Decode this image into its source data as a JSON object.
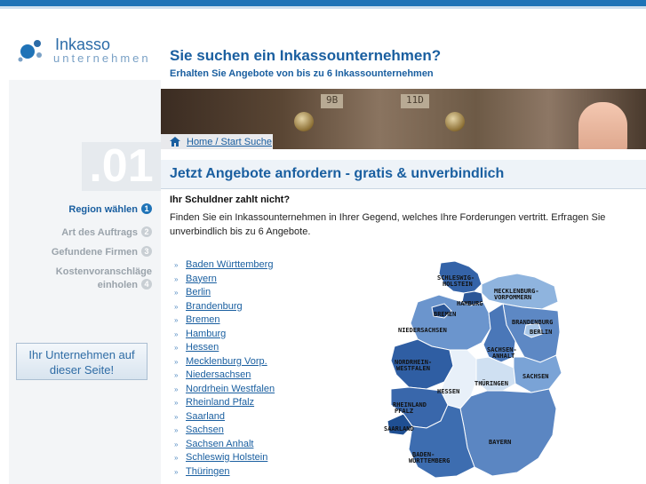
{
  "logo": {
    "line1": "Inkasso",
    "line2": "unternehmen"
  },
  "header": {
    "title": "Sie suchen ein Inkassounternehmen?",
    "subtitle": "Erhalten Sie Angebote von bis zu 6 Inkassounternehmen"
  },
  "photo": {
    "plate1": "9B",
    "plate2": "11D"
  },
  "breadcrumb": {
    "label": "Home / Start Suche"
  },
  "step_number": ".01",
  "main": {
    "title": "Jetzt Angebote anfordern - gratis & unverbindlich",
    "question": "Ihr Schuldner zahlt nicht?",
    "text": "Finden Sie ein Inkassounternehmen in Ihrer Gegend, welches Ihre Forderungen vertritt. Erfragen Sie unverbindlich bis zu 6 Angebote."
  },
  "steps": [
    {
      "label": "Region wählen",
      "num": "1",
      "active": true
    },
    {
      "label": "Art des Auftrags",
      "num": "2",
      "active": false
    },
    {
      "label": "Gefundene Firmen",
      "num": "3",
      "active": false
    },
    {
      "label": "Kostenvoranschläge einholen",
      "num": "4",
      "active": false
    }
  ],
  "side_button": {
    "line1": "Ihr Unternehmen auf",
    "line2": "dieser Seite!"
  },
  "regions": [
    "Baden Württemberg",
    "Bayern",
    "Berlin",
    "Brandenburg",
    "Bremen",
    "Hamburg",
    "Hessen",
    "Mecklenburg Vorp.",
    "Niedersachsen",
    "Nordrhein Westfalen",
    "Rheinland Pfalz",
    "Saarland",
    "Sachsen",
    "Sachsen Anhalt",
    "Schleswig Holstein",
    "Thüringen"
  ],
  "map_labels": {
    "sh": "SCHLESWIG-HOLSTEIN",
    "mv": "MECKLENBURG-VORPOMMERN",
    "hh": "HAMBURG",
    "hb": "BREMEN",
    "bb": "BRANDENBURG",
    "be": "BERLIN",
    "ni": "NIEDERSACHSEN",
    "st": "SACHSEN-ANHALT",
    "nw": "NORDRHEIN-WESTFALEN",
    "sn": "SACHSEN",
    "th": "THÜRINGEN",
    "he": "HESSEN",
    "rp": "RHEINLAND PFALZ",
    "sl": "SAARLAND",
    "by": "BAYERN",
    "bw": "BADEN-WÜRTTEMBERG"
  },
  "colors": {
    "brand": "#1f73b7",
    "link": "#1a5fa0"
  }
}
